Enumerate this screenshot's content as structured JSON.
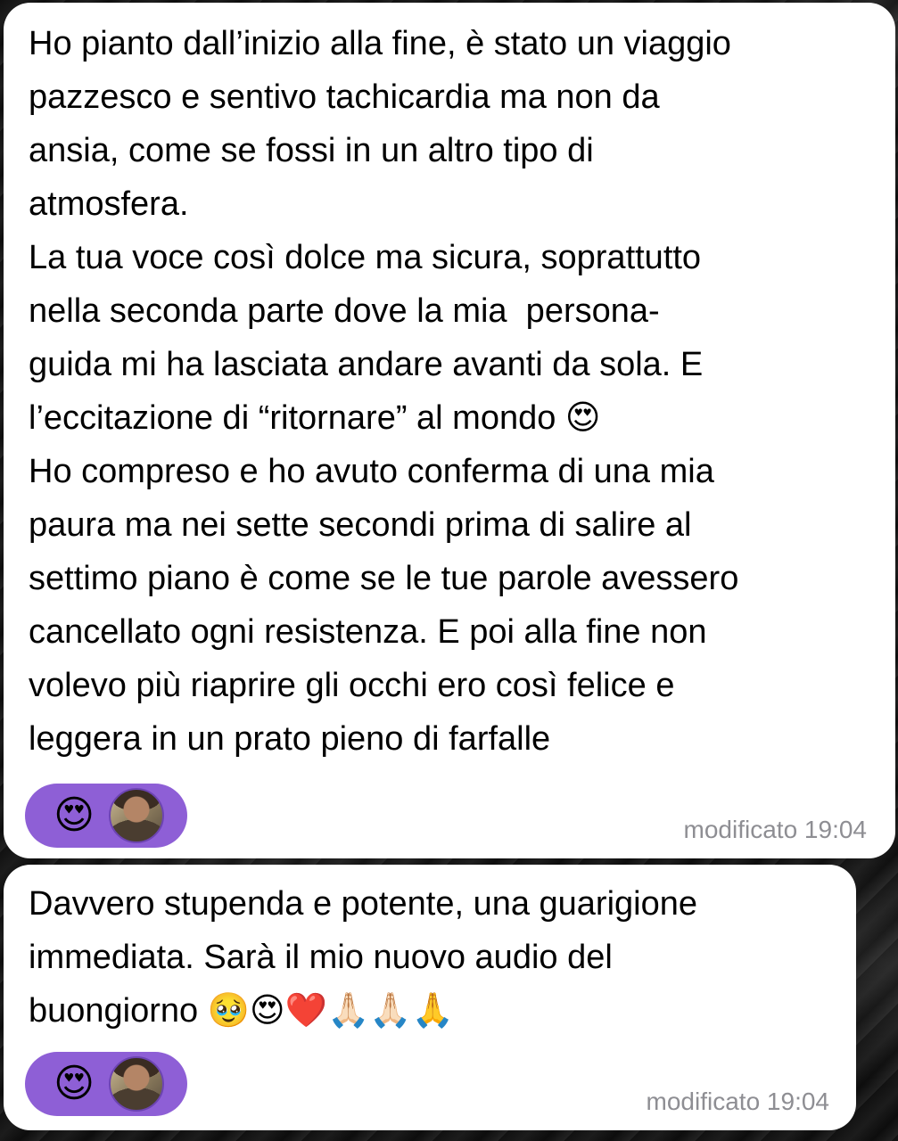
{
  "messages": [
    {
      "text": "Ho pianto dall’inizio alla fine, è stato un viaggio\npazzesco e sentivo tachicardia ma non da\nansia, come se fossi in un altro tipo di\natmosfera.\nLa tua voce così dolce ma sicura, soprattutto\nnella seconda parte dove la mia  persona-\nguida mi ha lasciata andare avanti da sola. E\nl’eccitazione di “ritornare” al mondo 😍\nHo compreso e ho avuto conferma di una mia\npaura ma nei sette secondi prima di salire al\nsettimo piano è come se le tue parole avessero\ncancellato ogni resistenza. E poi alla fine non\nvolevo più riaprire gli occhi ero così felice e\nleggera in un prato pieno di farfalle",
      "reaction_emoji": "😍",
      "timestamp": "modificato 19:04"
    },
    {
      "text": "Davvero stupenda e potente, una guarigione\nimmediata. Sarà il mio nuovo audio del\nbuongiorno 🥹😍❤️🙏🏻🙏🏻🙏",
      "reaction_emoji": "😍",
      "timestamp": "modificato 19:04"
    }
  ],
  "colors": {
    "bubble": "#ffffff",
    "reaction_pill": "#8e5fd6",
    "timestamp": "#8e8e93",
    "text": "#000000"
  }
}
